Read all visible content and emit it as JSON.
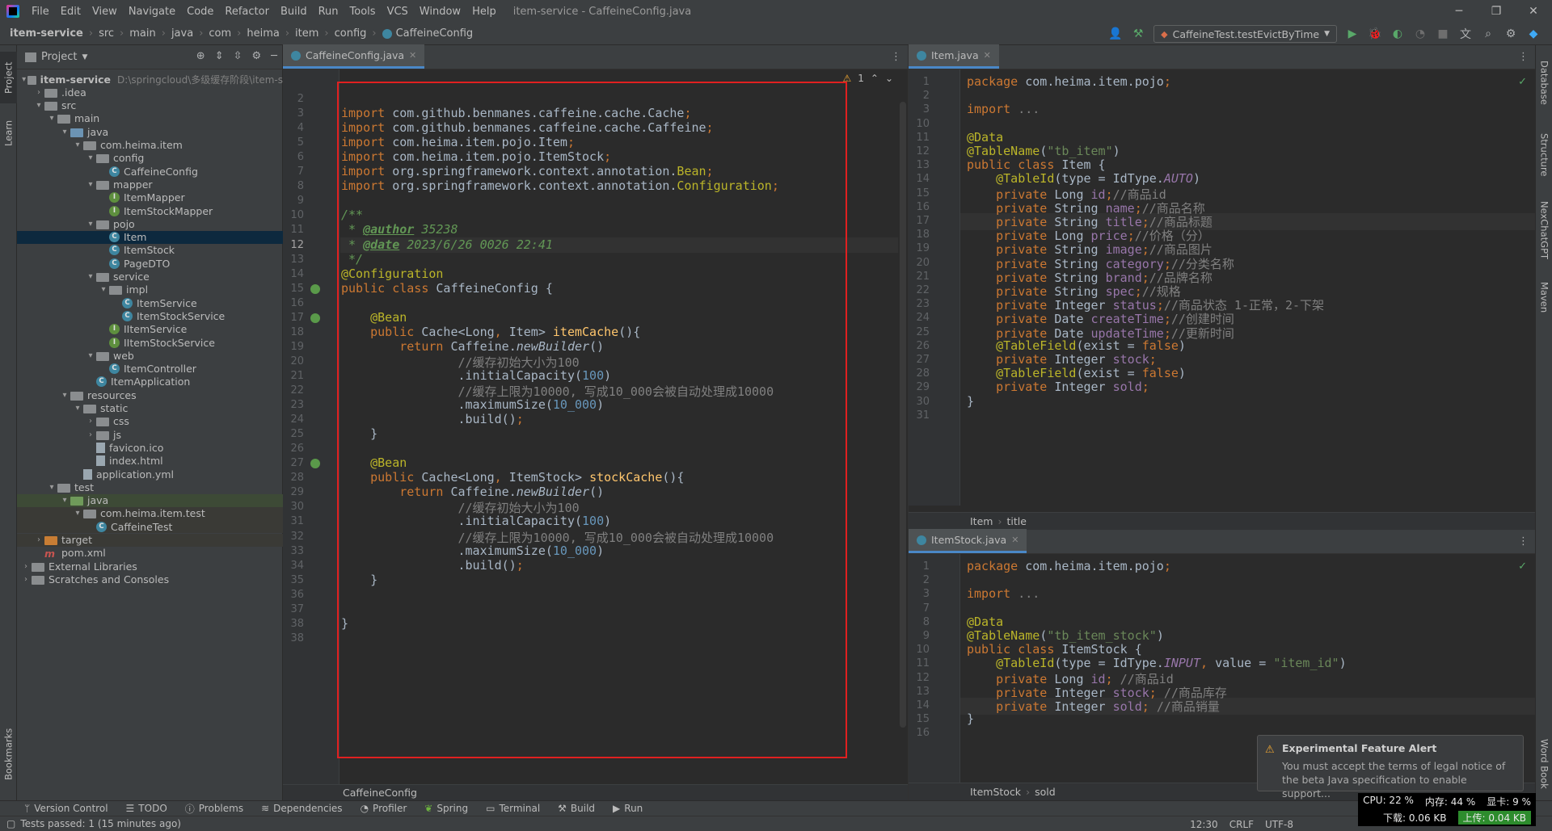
{
  "title_bar": {
    "menus": [
      "File",
      "Edit",
      "View",
      "Navigate",
      "Code",
      "Refactor",
      "Build",
      "Run",
      "Tools",
      "VCS",
      "Window",
      "Help"
    ],
    "window_title": "item-service - CaffeineConfig.java"
  },
  "nav_bar": {
    "breadcrumbs": [
      "item-service",
      "src",
      "main",
      "java",
      "com",
      "heima",
      "item",
      "config",
      "CaffeineConfig"
    ],
    "run_config": "CaffeineTest.testEvictByTime"
  },
  "left_strip": {
    "tabs": [
      "Project",
      "Learn",
      "Bookmarks"
    ]
  },
  "right_strip": {
    "tabs": [
      "Database",
      "Structure",
      "NexChatGPT",
      "Maven",
      "Word Book"
    ]
  },
  "project_panel": {
    "title": "Project",
    "tree": [
      {
        "depth": 0,
        "arrow": "▾",
        "kind": "module",
        "label": "item-service",
        "hint": "D:\\springcloud\\多级缓存阶段\\item-s",
        "bold": true
      },
      {
        "depth": 1,
        "arrow": "›",
        "kind": "folder",
        "label": ".idea"
      },
      {
        "depth": 1,
        "arrow": "▾",
        "kind": "folder",
        "label": "src"
      },
      {
        "depth": 2,
        "arrow": "▾",
        "kind": "folder",
        "label": "main"
      },
      {
        "depth": 3,
        "arrow": "▾",
        "kind": "folder-blue",
        "label": "java"
      },
      {
        "depth": 4,
        "arrow": "▾",
        "kind": "folder",
        "label": "com.heima.item"
      },
      {
        "depth": 5,
        "arrow": "▾",
        "kind": "folder",
        "label": "config"
      },
      {
        "depth": 6,
        "arrow": "",
        "kind": "class",
        "label": "CaffeineConfig"
      },
      {
        "depth": 5,
        "arrow": "▾",
        "kind": "folder",
        "label": "mapper"
      },
      {
        "depth": 6,
        "arrow": "",
        "kind": "interface",
        "label": "ItemMapper"
      },
      {
        "depth": 6,
        "arrow": "",
        "kind": "interface",
        "label": "ItemStockMapper"
      },
      {
        "depth": 5,
        "arrow": "▾",
        "kind": "folder",
        "label": "pojo"
      },
      {
        "depth": 6,
        "arrow": "",
        "kind": "class",
        "label": "Item",
        "selected": true
      },
      {
        "depth": 6,
        "arrow": "",
        "kind": "class",
        "label": "ItemStock"
      },
      {
        "depth": 6,
        "arrow": "",
        "kind": "class",
        "label": "PageDTO"
      },
      {
        "depth": 5,
        "arrow": "▾",
        "kind": "folder",
        "label": "service"
      },
      {
        "depth": 6,
        "arrow": "▾",
        "kind": "folder",
        "label": "impl"
      },
      {
        "depth": 7,
        "arrow": "",
        "kind": "class",
        "label": "ItemService"
      },
      {
        "depth": 7,
        "arrow": "",
        "kind": "class",
        "label": "ItemStockService"
      },
      {
        "depth": 6,
        "arrow": "",
        "kind": "interface",
        "label": "IItemService"
      },
      {
        "depth": 6,
        "arrow": "",
        "kind": "interface",
        "label": "IItemStockService"
      },
      {
        "depth": 5,
        "arrow": "▾",
        "kind": "folder",
        "label": "web"
      },
      {
        "depth": 6,
        "arrow": "",
        "kind": "class",
        "label": "ItemController"
      },
      {
        "depth": 5,
        "arrow": "",
        "kind": "class",
        "label": "ItemApplication"
      },
      {
        "depth": 3,
        "arrow": "▾",
        "kind": "folder-res",
        "label": "resources"
      },
      {
        "depth": 4,
        "arrow": "▾",
        "kind": "folder",
        "label": "static"
      },
      {
        "depth": 5,
        "arrow": "›",
        "kind": "folder",
        "label": "css"
      },
      {
        "depth": 5,
        "arrow": "›",
        "kind": "folder",
        "label": "js"
      },
      {
        "depth": 5,
        "arrow": "",
        "kind": "file",
        "label": "favicon.ico"
      },
      {
        "depth": 5,
        "arrow": "",
        "kind": "file",
        "label": "index.html"
      },
      {
        "depth": 4,
        "arrow": "",
        "kind": "file",
        "label": "application.yml"
      },
      {
        "depth": 2,
        "arrow": "▾",
        "kind": "folder",
        "label": "test"
      },
      {
        "depth": 3,
        "arrow": "▾",
        "kind": "folder-green",
        "label": "java",
        "highlight": true
      },
      {
        "depth": 4,
        "arrow": "▾",
        "kind": "folder",
        "label": "com.heima.item.test",
        "highlight2": true
      },
      {
        "depth": 5,
        "arrow": "",
        "kind": "class",
        "label": "CaffeineTest",
        "highlight2": true
      },
      {
        "depth": 1,
        "arrow": "›",
        "kind": "folder-orange",
        "label": "target",
        "highlight2": true
      },
      {
        "depth": 1,
        "arrow": "",
        "kind": "maven",
        "label": "pom.xml"
      },
      {
        "depth": 0,
        "arrow": "›",
        "kind": "lib",
        "label": "External Libraries"
      },
      {
        "depth": 0,
        "arrow": "›",
        "kind": "lib",
        "label": "Scratches and Consoles"
      }
    ]
  },
  "editor_main": {
    "tab": "CaffeineConfig.java",
    "warning_count": "1",
    "breadcrumb": "CaffeineConfig",
    "current_line": 12,
    "lines": [
      {
        "n": "2",
        "h": ""
      },
      {
        "n": "3",
        "h": "<span class='kw'>import </span>com.github.benmanes.caffeine.cache.Cache<span class='kw'>;</span>"
      },
      {
        "n": "4",
        "h": "<span class='kw'>import </span>com.github.benmanes.caffeine.cache.Caffeine<span class='kw'>;</span>"
      },
      {
        "n": "5",
        "h": "<span class='kw'>import </span>com.heima.item.pojo.Item<span class='kw'>;</span>"
      },
      {
        "n": "6",
        "h": "<span class='kw'>import </span>com.heima.item.pojo.ItemStock<span class='kw'>;</span>"
      },
      {
        "n": "7",
        "h": "<span class='kw'>import </span>org.springframework.context.annotation.<span class='an'>Bean</span><span class='kw'>;</span>"
      },
      {
        "n": "8",
        "h": "<span class='kw'>import </span>org.springframework.context.annotation.<span class='an'>Configuration</span><span class='kw'>;</span>"
      },
      {
        "n": "9",
        "h": ""
      },
      {
        "n": "10",
        "h": "<span class='doc'>/**</span>"
      },
      {
        "n": "11",
        "h": "<span class='doc'> * </span><span class='doctag'>@author</span><span class='doc'> 35238</span>"
      },
      {
        "n": "12",
        "h": "<span class='doc'> * </span><span class='doctag'>@date</span><span class='doc'> 2023/6/26 0026 22:41</span>"
      },
      {
        "n": "13",
        "h": "<span class='doc'> */</span>"
      },
      {
        "n": "14",
        "h": "<span class='an'>@Configuration</span>"
      },
      {
        "n": "15",
        "h": "<span class='kw'>public class </span>CaffeineConfig {"
      },
      {
        "n": "16",
        "h": ""
      },
      {
        "n": "17",
        "h": "    <span class='an'>@Bean</span>"
      },
      {
        "n": "18",
        "h": "    <span class='kw'>public </span>Cache&lt;Long<span class='kw'>, </span>Item&gt; <span class='fn'>itemCache</span>(){"
      },
      {
        "n": "19",
        "h": "        <span class='kw'>return </span>Caffeine.<span class='it'>newBuilder</span>()"
      },
      {
        "n": "20",
        "h": "                <span class='cm'>//缓存初始大小为100</span>"
      },
      {
        "n": "21",
        "h": "                .initialCapacity(<span class='num'>100</span>)"
      },
      {
        "n": "22",
        "h": "                <span class='cm'>//缓存上限为10000, 写成10_000会被自动处理成10000</span>"
      },
      {
        "n": "23",
        "h": "                .maximumSize(<span class='num'>10_000</span>)"
      },
      {
        "n": "24",
        "h": "                .build()<span class='kw'>;</span>"
      },
      {
        "n": "25",
        "h": "    }"
      },
      {
        "n": "26",
        "h": ""
      },
      {
        "n": "27",
        "h": "    <span class='an'>@Bean</span>"
      },
      {
        "n": "28",
        "h": "    <span class='kw'>public </span>Cache&lt;Long<span class='kw'>, </span>ItemStock&gt; <span class='fn'>stockCache</span>(){"
      },
      {
        "n": "29",
        "h": "        <span class='kw'>return </span>Caffeine.<span class='it'>newBuilder</span>()"
      },
      {
        "n": "30",
        "h": "                <span class='cm'>//缓存初始大小为100</span>"
      },
      {
        "n": "31",
        "h": "                .initialCapacity(<span class='num'>100</span>)"
      },
      {
        "n": "32",
        "h": "                <span class='cm'>//缓存上限为10000, 写成10_000会被自动处理成10000</span>"
      },
      {
        "n": "33",
        "h": "                .maximumSize(<span class='num'>10_000</span>)"
      },
      {
        "n": "34",
        "h": "                .build()<span class='kw'>;</span>"
      },
      {
        "n": "35",
        "h": "    }"
      },
      {
        "n": "36",
        "h": ""
      },
      {
        "n": "37",
        "h": ""
      },
      {
        "n": "38",
        "h": "}"
      },
      {
        "n": "38",
        "h": ""
      }
    ]
  },
  "editor_item": {
    "tab": "Item.java",
    "breadcrumb": [
      "Item",
      "title"
    ],
    "current_line": 17,
    "lines": [
      {
        "n": "1",
        "h": "<span class='kw'>package </span>com.heima.item.pojo<span class='kw'>;</span>"
      },
      {
        "n": "2",
        "h": ""
      },
      {
        "n": "3",
        "h": "<span class='kw'>import </span><span class='cm'>...</span>"
      },
      {
        "n": "10",
        "h": ""
      },
      {
        "n": "11",
        "h": "<span class='an'>@Data</span>"
      },
      {
        "n": "12",
        "h": "<span class='an'>@TableName</span>(<span class='str'>\"tb_item\"</span>)"
      },
      {
        "n": "13",
        "h": "<span class='kw'>public class </span>Item {"
      },
      {
        "n": "14",
        "h": "    <span class='an'>@TableId</span>(type = IdType.<span class='cst'>AUTO</span>)"
      },
      {
        "n": "15",
        "h": "    <span class='kw'>private </span>Long <span class='fld'>id</span><span class='kw'>;</span><span class='cm'>//商品id</span>"
      },
      {
        "n": "16",
        "h": "    <span class='kw'>private </span>String <span class='fld'>name</span><span class='kw'>;</span><span class='cm'>//商品名称</span>"
      },
      {
        "n": "17",
        "h": "    <span class='kw'>private </span>String <span class='fld'>title</span><span class='kw'>;</span><span class='cm'>//商品标题</span>"
      },
      {
        "n": "18",
        "h": "    <span class='kw'>private </span>Long <span class='fld'>price</span><span class='kw'>;</span><span class='cm'>//价格（分）</span>"
      },
      {
        "n": "19",
        "h": "    <span class='kw'>private </span>String <span class='fld'>image</span><span class='kw'>;</span><span class='cm'>//商品图片</span>"
      },
      {
        "n": "20",
        "h": "    <span class='kw'>private </span>String <span class='fld'>category</span><span class='kw'>;</span><span class='cm'>//分类名称</span>"
      },
      {
        "n": "21",
        "h": "    <span class='kw'>private </span>String <span class='fld'>brand</span><span class='kw'>;</span><span class='cm'>//品牌名称</span>"
      },
      {
        "n": "22",
        "h": "    <span class='kw'>private </span>String <span class='fld'>spec</span><span class='kw'>;</span><span class='cm'>//规格</span>"
      },
      {
        "n": "23",
        "h": "    <span class='kw'>private </span>Integer <span class='fld'>status</span><span class='kw'>;</span><span class='cm'>//商品状态 1-正常，2-下架</span>"
      },
      {
        "n": "24",
        "h": "    <span class='kw'>private </span>Date <span class='fld'>createTime</span><span class='kw'>;</span><span class='cm'>//创建时间</span>"
      },
      {
        "n": "25",
        "h": "    <span class='kw'>private </span>Date <span class='fld'>updateTime</span><span class='kw'>;</span><span class='cm'>//更新时间</span>"
      },
      {
        "n": "26",
        "h": "    <span class='an'>@TableField</span>(exist = <span class='kw'>false</span>)"
      },
      {
        "n": "27",
        "h": "    <span class='kw'>private </span>Integer <span class='fld'>stock</span><span class='kw'>;</span>"
      },
      {
        "n": "28",
        "h": "    <span class='an'>@TableField</span>(exist = <span class='kw'>false</span>)"
      },
      {
        "n": "29",
        "h": "    <span class='kw'>private </span>Integer <span class='fld'>sold</span><span class='kw'>;</span>"
      },
      {
        "n": "30",
        "h": "}"
      },
      {
        "n": "31",
        "h": ""
      }
    ]
  },
  "editor_itemstock": {
    "tab": "ItemStock.java",
    "breadcrumb": [
      "ItemStock",
      "sold"
    ],
    "current_line": 14,
    "lines": [
      {
        "n": "1",
        "h": "<span class='kw'>package </span>com.heima.item.pojo<span class='kw'>;</span>"
      },
      {
        "n": "2",
        "h": ""
      },
      {
        "n": "3",
        "h": "<span class='kw'>import </span><span class='cm'>...</span>"
      },
      {
        "n": "7",
        "h": ""
      },
      {
        "n": "8",
        "h": "<span class='an'>@Data</span>"
      },
      {
        "n": "9",
        "h": "<span class='an'>@TableName</span>(<span class='str'>\"tb_item_stock\"</span>)"
      },
      {
        "n": "10",
        "h": "<span class='kw'>public class </span>ItemStock {"
      },
      {
        "n": "11",
        "h": "    <span class='an'>@TableId</span>(type = IdType.<span class='cst'>INPUT</span><span class='kw'>, </span>value = <span class='str'>\"item_id\"</span>)"
      },
      {
        "n": "12",
        "h": "    <span class='kw'>private </span>Long <span class='fld'>id</span><span class='kw'>; </span><span class='cm'>//商品id</span>"
      },
      {
        "n": "13",
        "h": "    <span class='kw'>private </span>Integer <span class='fld'>stock</span><span class='kw'>; </span><span class='cm'>//商品库存</span>"
      },
      {
        "n": "14",
        "h": "    <span class='kw'>private </span>Integer <span class='fld'>sold</span><span class='kw'>; </span><span class='cm'>//商品销量</span>"
      },
      {
        "n": "15",
        "h": "}"
      },
      {
        "n": "16",
        "h": ""
      }
    ]
  },
  "notification": {
    "title": "Experimental Feature Alert",
    "body": "You must accept the terms of legal notice of the beta Java specification to enable support..."
  },
  "bottom_tools": [
    "Version Control",
    "TODO",
    "Problems",
    "Dependencies",
    "Profiler",
    "Spring",
    "Terminal",
    "Build",
    "Run"
  ],
  "status_bar": {
    "message": "Tests passed: 1 (15 minutes ago)",
    "position": "12:30",
    "line_sep": "CRLF",
    "encoding": "UTF-8"
  },
  "perf_overlay": {
    "cpu": "CPU: 22 %",
    "mem": "内存: 44 %",
    "gpu": "显卡: 9 %",
    "down": "下载: 0.06 KB",
    "up": "上传: 0.04 KB"
  },
  "colors": {
    "keyword": "#cc7832",
    "annotation": "#bbb529",
    "string": "#6a8759",
    "number": "#6897bb",
    "comment": "#808080",
    "selection_box": "#e02020"
  }
}
